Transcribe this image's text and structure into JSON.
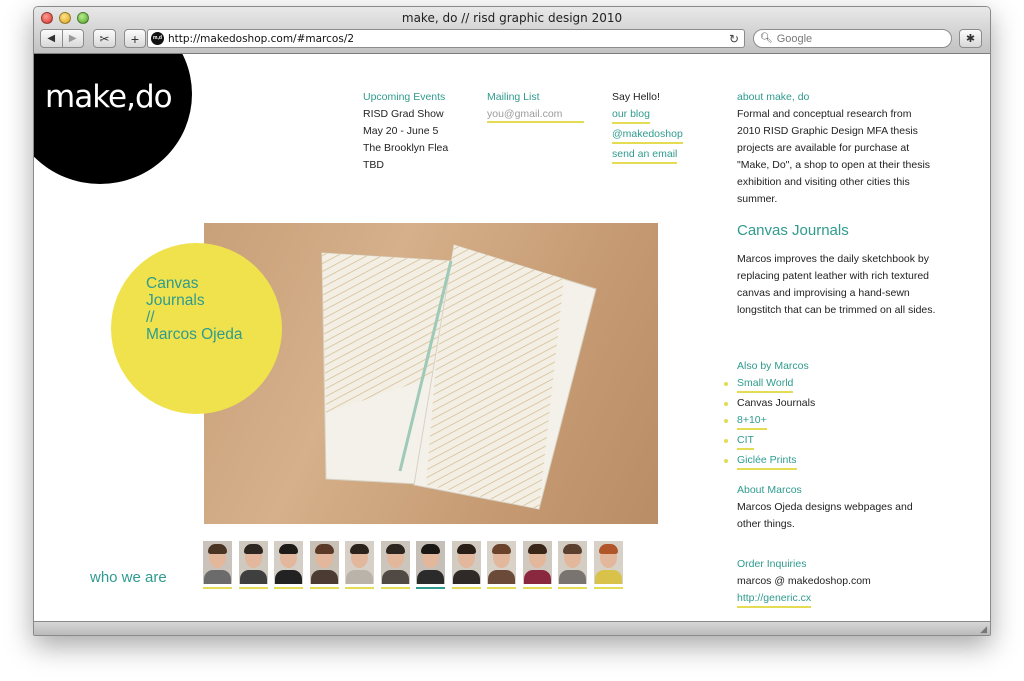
{
  "window": {
    "title": "make, do // risd graphic design 2010",
    "url": "http://makedoshop.com/#marcos/2",
    "search_placeholder": "Google",
    "back_glyph": "◀",
    "forward_glyph": "▶",
    "plus_glyph": "+",
    "reload_glyph": "↻",
    "favicon_text": "m,d"
  },
  "logo": {
    "text": "make,do",
    "color": "#000000"
  },
  "events": {
    "heading": "Upcoming Events",
    "lines": [
      "RISD Grad Show",
      "May 20 - June 5",
      "The Brooklyn Flea",
      "TBD"
    ]
  },
  "mailing": {
    "heading": "Mailing List",
    "placeholder": "you@gmail.com"
  },
  "hello": {
    "heading": "Say Hello!",
    "links": [
      "our blog",
      "@makedoshop",
      "send an email"
    ]
  },
  "about": {
    "heading": "about make, do",
    "text": "Formal and conceptual research from 2010 RISD Graphic Design MFA thesis projects are available for purchase at \"Make, Do\", a shop to open at their thesis exhibition and visiting other cities this summer."
  },
  "project": {
    "badge_lines": [
      "Canvas",
      "Journals",
      "//",
      "Marcos Ojeda"
    ],
    "badge_color": "#f0e24c",
    "title": "Canvas Journals",
    "description": "Marcos improves the daily sketchbook by replacing patent leather with rich textured canvas and improvising a hand-sewn longstitch that can be trimmed on all sides."
  },
  "also_by": {
    "heading": "Also by Marcos",
    "items": [
      {
        "label": "Small World",
        "link": true
      },
      {
        "label": "Canvas Journals",
        "link": false
      },
      {
        "label": "8+10+",
        "link": true
      },
      {
        "label": "CIT",
        "link": true
      },
      {
        "label": "Giclée Prints",
        "link": true
      }
    ]
  },
  "about_marcos": {
    "heading": "About Marcos",
    "text": "Marcos Ojeda designs webpages and other things."
  },
  "order": {
    "heading": "Order Inquiries",
    "email": "marcos @ makedoshop.com",
    "link": "http://generic.cx"
  },
  "who_we_are": "who we are",
  "colors": {
    "accent": "#2f9b8e",
    "underline": "#e4dc52"
  }
}
